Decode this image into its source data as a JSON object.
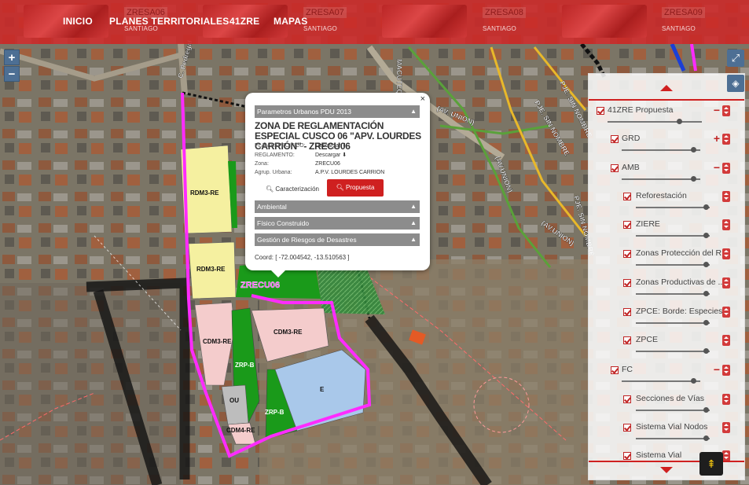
{
  "nav": {
    "items": [
      "INICIO",
      "PLANES TERRITORIALES",
      "41ZRE",
      "MAPAS"
    ]
  },
  "thumbnails": [
    {
      "title": "ZRESA06",
      "subtitle": "SANTIAGO"
    },
    {
      "title": "ZRESA07",
      "subtitle": "SANTIAGO"
    },
    {
      "title": "ZRESA08",
      "subtitle": "SANTIAGO"
    },
    {
      "title": "ZRESA09",
      "subtitle": "SANTIAGO"
    }
  ],
  "map_controls": {
    "zoom_in": "+",
    "zoom_out": "−"
  },
  "map_labels": {
    "zone_name": "ZRECU06",
    "parcels": [
      "RDM3-RE",
      "RDM3-RE",
      "CDM3-RE",
      "CDM3-RE",
      "ZRP-B",
      "OU",
      "ZRP-B",
      "E",
      "CDM4-RE"
    ],
    "streets": [
      "PJE. SIN NOMBRE",
      "PJE. SIN NOMBRE",
      "(AV. UNION)",
      "(AV.UNION)",
      "(AV.UNION)",
      "PJE. SIN NOMBRE",
      "C. Pedregal",
      "MACUTEQ"
    ]
  },
  "popup": {
    "close": "×",
    "header": "Parametros Urbanos PDU 2013",
    "title": "ZONA DE REGLAMENTACIÓN ESPECIAL CUSCO 06 \"APV. LOURDES CARRIÓN\" - ZRECU06",
    "rows": [
      {
        "key": "PLAN ESPECIFICO:",
        "value": "Descargar ⬇"
      },
      {
        "key": "REGLAMENTO:",
        "value": "Descargar ⬇"
      },
      {
        "key": "Zona:",
        "value": "ZRECU06"
      },
      {
        "key": "Agrup. Urbana:",
        "value": "A.P.V. LOURDES CARRION"
      }
    ],
    "btn_caracterizacion": "Caracterización",
    "btn_propuesta": "Propuesta",
    "sections": [
      "Ambiental",
      "Físico Construido",
      "Gestión de Riesgos de Desastres"
    ],
    "coord": "Coord: [ -72.004542, -13.510563 ]"
  },
  "layers": [
    {
      "label": "41ZRE Propuesta",
      "level": 0,
      "toggle": "−"
    },
    {
      "label": "GRD",
      "level": 1,
      "toggle": "+"
    },
    {
      "label": "AMB",
      "level": 1,
      "toggle": "−"
    },
    {
      "label": "Reforestación",
      "level": 2
    },
    {
      "label": "ZIERE",
      "level": 2
    },
    {
      "label": "Zonas Protección del R...",
      "level": 2
    },
    {
      "label": "Zonas Productivas de ...",
      "level": 2
    },
    {
      "label": "ZPCE: Borde: Especies",
      "level": 2
    },
    {
      "label": "ZPCE",
      "level": 2
    },
    {
      "label": "FC",
      "level": 1,
      "toggle": "−"
    },
    {
      "label": "Secciones de Vías",
      "level": 2
    },
    {
      "label": "Sistema Vial Nodos",
      "level": 2
    },
    {
      "label": "Sistema Vial",
      "level": 2
    }
  ],
  "colors": {
    "topbar": "#cd2828",
    "zone_outline": "#ff2bff",
    "residential": "#f5f0a0",
    "commercial": "#f4cccc",
    "green": "#1a9a1a",
    "education": "#a9c8ea"
  },
  "back_to_top": "⇞"
}
